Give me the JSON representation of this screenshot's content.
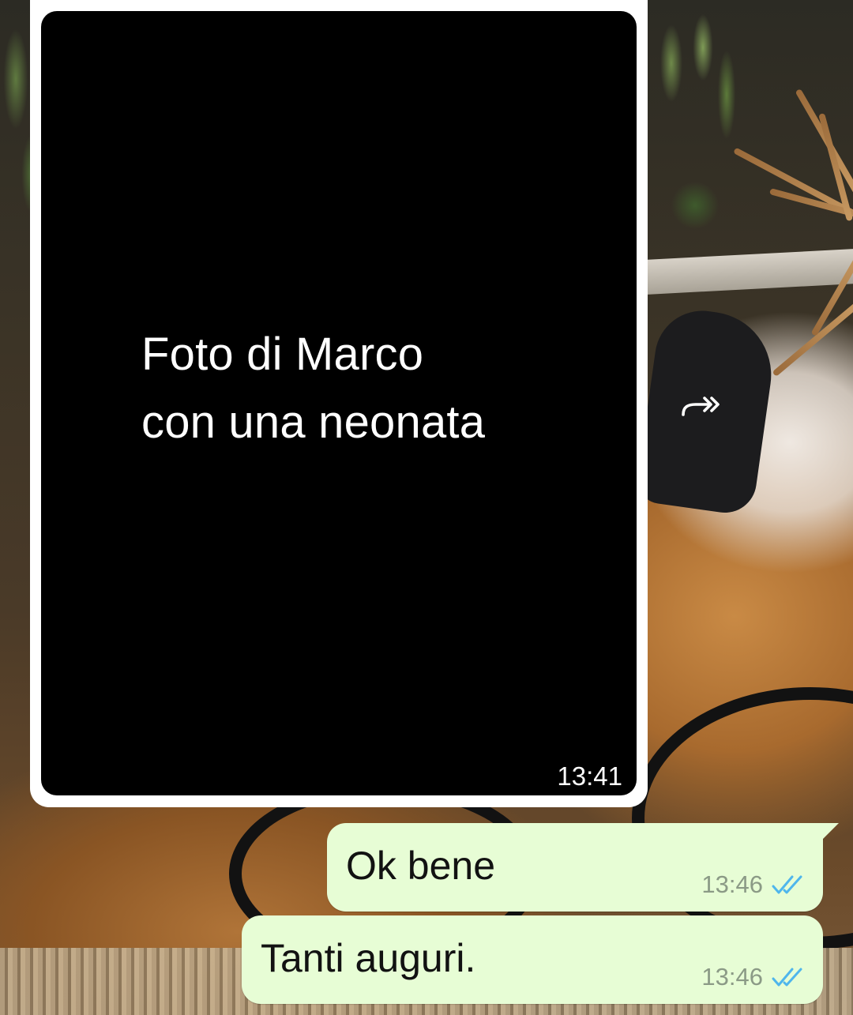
{
  "chat": {
    "messages": [
      {
        "direction": "incoming",
        "type": "image",
        "image_caption_lines": [
          "Foto di Marco",
          "con una neonata"
        ],
        "time": "13:41"
      },
      {
        "direction": "outgoing",
        "type": "text",
        "text": "Ok bene",
        "time": "13:46",
        "status": "read"
      },
      {
        "direction": "outgoing",
        "type": "text",
        "text": "Tanti auguri.",
        "time": "13:46",
        "status": "read"
      }
    ]
  },
  "icons": {
    "forward": "forward-icon",
    "read_receipt": "double-check-icon"
  },
  "colors": {
    "outgoing_bubble": "#e7fdd5",
    "incoming_bubble": "#ffffff",
    "read_tick": "#4fb6ec",
    "time_outgoing": "#8b9a86"
  }
}
